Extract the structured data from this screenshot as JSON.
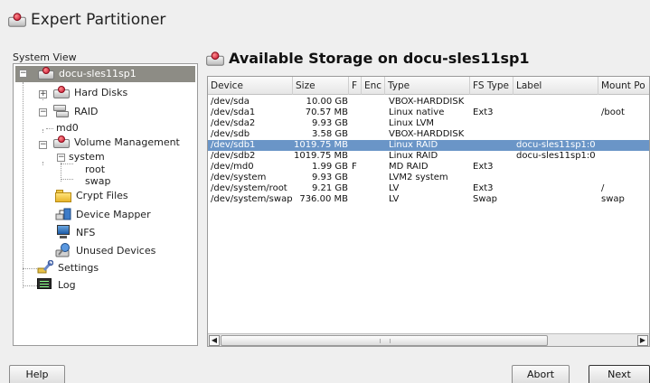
{
  "app": {
    "title": "Expert Partitioner"
  },
  "system_view": {
    "label": "System View",
    "root": "docu-sles11sp1",
    "nodes": [
      {
        "label": "Hard Disks"
      },
      {
        "label": "RAID"
      },
      {
        "label": "md0"
      },
      {
        "label": "Volume Management"
      },
      {
        "label": "system"
      },
      {
        "label": "root"
      },
      {
        "label": "swap"
      },
      {
        "label": "Crypt Files"
      },
      {
        "label": "Device Mapper"
      },
      {
        "label": "NFS"
      },
      {
        "label": "Unused Devices"
      },
      {
        "label": "Settings"
      },
      {
        "label": "Log"
      }
    ]
  },
  "storage": {
    "title": "Available Storage on docu-sles11sp1",
    "columns": [
      "Device",
      "Size",
      "F",
      "Enc",
      "Type",
      "FS Type",
      "Label",
      "Mount Po"
    ],
    "rows": [
      {
        "device": "/dev/sda",
        "size": "10.00 GB",
        "f": "",
        "enc": "",
        "type": "VBOX-HARDDISK",
        "fstype": "",
        "label": "",
        "mount": ""
      },
      {
        "device": "/dev/sda1",
        "size": "70.57 MB",
        "f": "",
        "enc": "",
        "type": "Linux native",
        "fstype": "Ext3",
        "label": "",
        "mount": "/boot"
      },
      {
        "device": "/dev/sda2",
        "size": "9.93 GB",
        "f": "",
        "enc": "",
        "type": "Linux LVM",
        "fstype": "",
        "label": "",
        "mount": ""
      },
      {
        "device": "/dev/sdb",
        "size": "3.58 GB",
        "f": "",
        "enc": "",
        "type": "VBOX-HARDDISK",
        "fstype": "",
        "label": "",
        "mount": ""
      },
      {
        "device": "/dev/sdb1",
        "size": "1019.75 MB",
        "f": "",
        "enc": "",
        "type": "Linux RAID",
        "fstype": "",
        "label": "docu-sles11sp1:0",
        "mount": "",
        "selected": true
      },
      {
        "device": "/dev/sdb2",
        "size": "1019.75 MB",
        "f": "",
        "enc": "",
        "type": "Linux RAID",
        "fstype": "",
        "label": "docu-sles11sp1:0",
        "mount": ""
      },
      {
        "device": "/dev/md0",
        "size": "1.99 GB",
        "f": "F",
        "enc": "",
        "type": "MD RAID",
        "fstype": "Ext3",
        "label": "",
        "mount": ""
      },
      {
        "device": "/dev/system",
        "size": "9.93 GB",
        "f": "",
        "enc": "",
        "type": "LVM2 system",
        "fstype": "",
        "label": "",
        "mount": ""
      },
      {
        "device": "/dev/system/root",
        "size": "9.21 GB",
        "f": "",
        "enc": "",
        "type": "LV",
        "fstype": "Ext3",
        "label": "",
        "mount": "/"
      },
      {
        "device": "/dev/system/swap",
        "size": "736.00 MB",
        "f": "",
        "enc": "",
        "type": "LV",
        "fstype": "Swap",
        "label": "",
        "mount": "swap"
      }
    ]
  },
  "buttons": {
    "help": "Help",
    "abort": "Abort",
    "next": "Next"
  },
  "colors": {
    "selection": "#6a95c7",
    "tree_root_bar": "#8d8c85",
    "disk_icon_red": "#c8102e"
  }
}
